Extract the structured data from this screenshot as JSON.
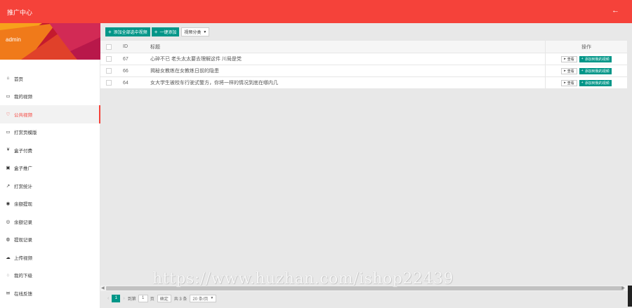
{
  "header": {
    "title": "推广中心",
    "back_icon": "←"
  },
  "sidebar": {
    "username": "admin",
    "items": [
      {
        "label": "首页",
        "icon": "home-icon"
      },
      {
        "label": "我的视频",
        "icon": "video-icon"
      },
      {
        "label": "公共视频",
        "icon": "heart-icon",
        "active": true
      },
      {
        "label": "打赏页模版",
        "icon": "template-icon"
      },
      {
        "label": "盒子付费",
        "icon": "fee-icon"
      },
      {
        "label": "盒子推广",
        "icon": "promo-icon"
      },
      {
        "label": "打赏统计",
        "icon": "stats-icon"
      },
      {
        "label": "余额提现",
        "icon": "withdraw-icon"
      },
      {
        "label": "余额记录",
        "icon": "record-icon"
      },
      {
        "label": "提现记录",
        "icon": "history-icon"
      },
      {
        "label": "上传视频",
        "icon": "upload-icon"
      },
      {
        "label": "我的下级",
        "icon": "team-icon"
      },
      {
        "label": "在线反馈",
        "icon": "feedback-icon"
      }
    ]
  },
  "toolbar": {
    "add_selected": "添加全部选中视频",
    "one_click_add": "一键添加",
    "category_select": "视频分类"
  },
  "table": {
    "headers": {
      "id": "ID",
      "title": "标题",
      "ops": "操作"
    },
    "view_label": "查看",
    "add_label": "添加到我的视频",
    "rows": [
      {
        "id": "67",
        "title": "心碎不已 老头太太要去理解这件 川局是党"
      },
      {
        "id": "66",
        "title": "揭秘女教练在女教练日前的隐患"
      },
      {
        "id": "64",
        "title": "女大学生被校车行驶式警方，你将一样的情况到底在哪内几"
      }
    ]
  },
  "pager": {
    "current": "1",
    "goto_label": "到第",
    "page_input": "1",
    "page_unit": "页",
    "confirm": "确定",
    "total": "共 3 条",
    "page_size": "20 条/页"
  },
  "watermark": "https://www.huzhan.com/ishop22439",
  "colors": {
    "brand": "#f5423a",
    "accent": "#009688"
  }
}
